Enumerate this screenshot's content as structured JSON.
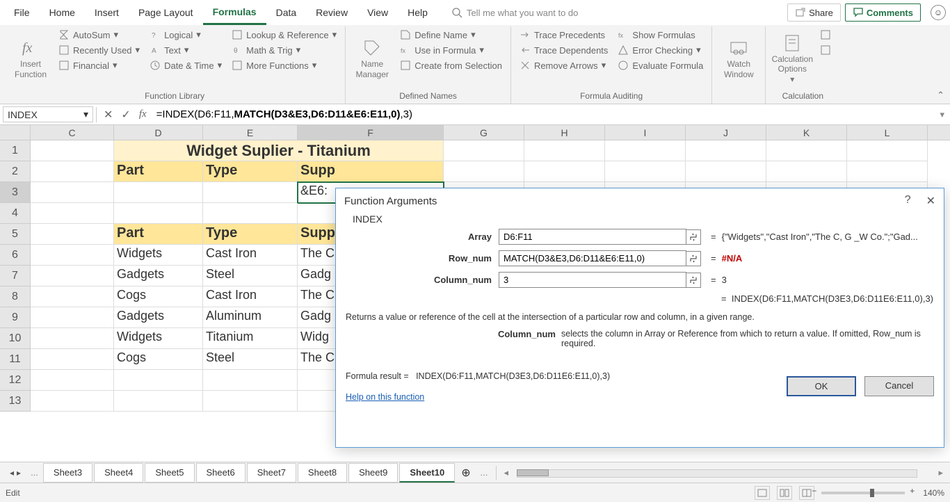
{
  "menu": {
    "tabs": [
      "File",
      "Home",
      "Insert",
      "Page Layout",
      "Formulas",
      "Data",
      "Review",
      "View",
      "Help"
    ],
    "active": "Formulas",
    "search_placeholder": "Tell me what you want to do",
    "share": "Share",
    "comments": "Comments"
  },
  "ribbon": {
    "groups": {
      "function_library": {
        "label": "Function Library",
        "insert_fn_top": "Insert",
        "insert_fn_bot": "Function",
        "col1": [
          "AutoSum",
          "Recently Used",
          "Financial"
        ],
        "col2": [
          "Logical",
          "Text",
          "Date & Time"
        ],
        "col3": [
          "Lookup & Reference",
          "Math & Trig",
          "More Functions"
        ]
      },
      "defined_names": {
        "label": "Defined Names",
        "name_mgr_top": "Name",
        "name_mgr_bot": "Manager",
        "items": [
          "Define Name",
          "Use in Formula",
          "Create from Selection"
        ]
      },
      "auditing": {
        "label": "Formula Auditing",
        "col1": [
          "Trace Precedents",
          "Trace Dependents",
          "Remove Arrows"
        ],
        "col2": [
          "Show Formulas",
          "Error Checking",
          "Evaluate Formula"
        ]
      },
      "watch": {
        "top": "Watch",
        "bot": "Window"
      },
      "calc": {
        "label": "Calculation",
        "top": "Calculation",
        "bot": "Options"
      }
    }
  },
  "formulabar": {
    "namebox": "INDEX",
    "formula_prefix": "=INDEX(D6:F11,",
    "formula_match": "MATCH(D3&E3,D6:D11&E6:E11,0)",
    "formula_suffix": ",3)"
  },
  "grid": {
    "col_widths": {
      "C": 120,
      "D": 128,
      "E": 136,
      "F": 210,
      "G": 116,
      "H": 116,
      "I": 116,
      "J": 116,
      "K": 116,
      "L": 116
    },
    "cols": [
      "C",
      "D",
      "E",
      "F",
      "G",
      "H",
      "I",
      "J",
      "K",
      "L"
    ],
    "row_heads": [
      "1",
      "2",
      "3",
      "4",
      "5",
      "6",
      "7",
      "8",
      "9",
      "10",
      "11",
      "12",
      "13"
    ],
    "title": "Widget Suplier - Titanium",
    "headers5": {
      "D": "Part",
      "E": "Type",
      "F": "Supp"
    },
    "headers2": {
      "D": "Part",
      "E": "Type",
      "F": "Supp"
    },
    "f3_display": "&E6:",
    "rows": [
      {
        "D": "Widgets",
        "E": "Cast Iron",
        "F": "The C"
      },
      {
        "D": "Gadgets",
        "E": "Steel",
        "F": "Gadg"
      },
      {
        "D": "Cogs",
        "E": "Cast Iron",
        "F": "The C"
      },
      {
        "D": "Gadgets",
        "E": "Aluminum",
        "F": "Gadg"
      },
      {
        "D": "Widgets",
        "E": "Titanium",
        "F": "Widg"
      },
      {
        "D": "Cogs",
        "E": "Steel",
        "F": "The C"
      }
    ]
  },
  "dialog": {
    "title": "Function Arguments",
    "fn": "INDEX",
    "args": [
      {
        "label": "Array",
        "value": "D6:F11",
        "result": "{\"Widgets\",\"Cast Iron\",\"The C, G _W Co.\";\"Gad..."
      },
      {
        "label": "Row_num",
        "value": "MATCH(D3&E3,D6:D11&E6:E11,0)",
        "result": "#N/A",
        "err": true
      },
      {
        "label": "Column_num",
        "value": "3",
        "result": "3"
      }
    ],
    "overall_eq": "INDEX(D6:F11,MATCH(D3E3,D6:D11E6:E11,0),3)",
    "desc": "Returns a value or reference of the cell at the intersection of a particular row and column, in a given range.",
    "param_name": "Column_num",
    "param_desc": "selects the column in Array or Reference from which to return a value. If omitted, Row_num is required.",
    "formula_result_label": "Formula result =",
    "formula_result": "INDEX(D6:F11,MATCH(D3E3,D6:D11E6:E11,0),3)",
    "help_link": "Help on this function",
    "ok": "OK",
    "cancel": "Cancel"
  },
  "sheets": {
    "ellipsis": "...",
    "tabs": [
      "Sheet3",
      "Sheet4",
      "Sheet5",
      "Sheet6",
      "Sheet7",
      "Sheet8",
      "Sheet9",
      "Sheet10"
    ],
    "active": "Sheet10"
  },
  "statusbar": {
    "mode": "Edit",
    "zoom": "140%"
  }
}
